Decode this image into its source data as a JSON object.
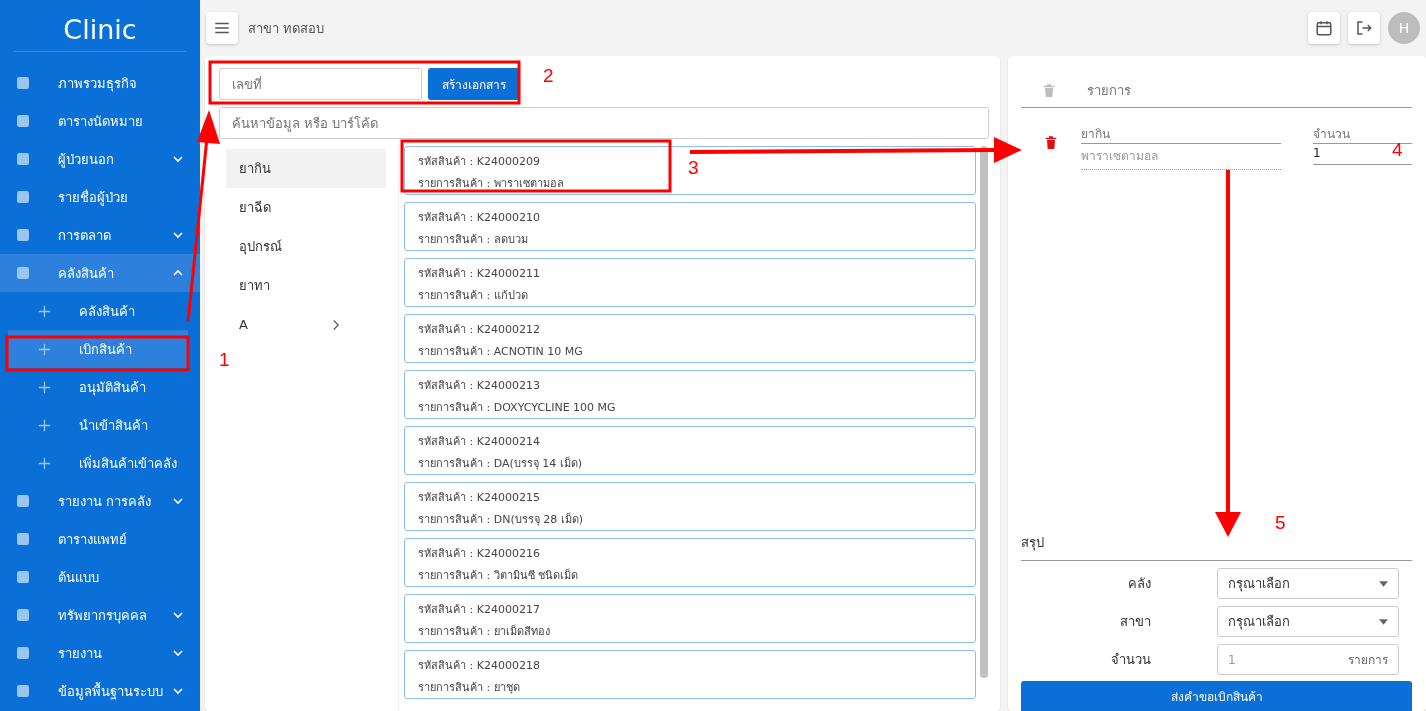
{
  "sidebar": {
    "logo": "Clinic",
    "items": [
      {
        "label": "ภาพรวมธุรกิจ",
        "selected": false
      },
      {
        "label": "ตารางนัดหมาย",
        "selected": false
      },
      {
        "label": "ผู้ป่วยนอก",
        "selected": false,
        "expanded": false
      },
      {
        "label": "รายชื่อผู้ป่วย",
        "selected": false
      },
      {
        "label": "การตลาด",
        "selected": false,
        "expanded": false
      },
      {
        "label": "คลังสินค้า",
        "selected": false,
        "expanded": true,
        "children": [
          {
            "label": "คลังสินค้า",
            "selected": false
          },
          {
            "label": "เบิกสินค้า",
            "selected": true
          },
          {
            "label": "อนุมัติสินค้า",
            "selected": false
          },
          {
            "label": "นำเข้าสินค้า",
            "selected": false
          },
          {
            "label": "เพิ่มสินค้าเข้าคลัง",
            "selected": false
          }
        ]
      },
      {
        "label": "รายงาน การคลัง",
        "selected": false,
        "expanded": false
      },
      {
        "label": "ตารางแพทย์",
        "selected": false
      },
      {
        "label": "ต้นแบบ",
        "selected": false
      },
      {
        "label": "ทรัพยากรบุคคล",
        "selected": false,
        "expanded": false
      },
      {
        "label": "รายงาน",
        "selected": false,
        "expanded": false
      },
      {
        "label": "ข้อมูลพื้นฐานระบบ",
        "selected": false,
        "expanded": false
      }
    ]
  },
  "topbar": {
    "branch": "สาขา ทดสอบ",
    "avatar": "H"
  },
  "document": {
    "number_placeholder": "เลขที่",
    "create_button": "สร้างเอกสาร",
    "search_placeholder": "ค้นหาข้อมูล หรือ บาร์โค้ด"
  },
  "categories": [
    {
      "label": "ยากิน",
      "selected": true,
      "kind": "item"
    },
    {
      "label": "ยาฉีด",
      "selected": false,
      "kind": "item"
    },
    {
      "label": "อุปกรณ์",
      "selected": false,
      "kind": "item"
    },
    {
      "label": "ยาทา",
      "selected": false,
      "kind": "item"
    },
    {
      "label": "A",
      "selected": false,
      "kind": "group"
    }
  ],
  "products": [
    {
      "code": "รหัสสินค้า : K24000209",
      "name": "รายการสินค้า : พาราเซตามอล"
    },
    {
      "code": "รหัสสินค้า : K24000210",
      "name": "รายการสินค้า : ลดบวม"
    },
    {
      "code": "รหัสสินค้า : K24000211",
      "name": "รายการสินค้า : แก้ปวด"
    },
    {
      "code": "รหัสสินค้า : K24000212",
      "name": "รายการสินค้า : ACNOTIN 10 MG"
    },
    {
      "code": "รหัสสินค้า : K24000213",
      "name": "รายการสินค้า : DOXYCYCLINE 100 MG"
    },
    {
      "code": "รหัสสินค้า : K24000214",
      "name": "รายการสินค้า : DA(บรรจุ 14 เม็ด)"
    },
    {
      "code": "รหัสสินค้า : K24000215",
      "name": "รายการสินค้า : DN(บรรจุ 28 เม็ด)"
    },
    {
      "code": "รหัสสินค้า : K24000216",
      "name": "รายการสินค้า : วิตามินซี ชนิดเม็ด"
    },
    {
      "code": "รหัสสินค้า : K24000217",
      "name": "รายการสินค้า : ยาเม็ดสีทอง"
    },
    {
      "code": "รหัสสินค้า : K24000218",
      "name": "รายการสินค้า : ยาชุด"
    }
  ],
  "cart": {
    "header": "รายการ",
    "lines": [
      {
        "category": "ยากิน",
        "name": "พาราเซตามอล",
        "quantity_label": "จำนวน",
        "quantity": "1"
      }
    ]
  },
  "summary": {
    "title": "สรุป",
    "fields": [
      {
        "kind": "select",
        "label": "คลัง",
        "value": "กรุณาเลือก"
      },
      {
        "kind": "select",
        "label": "สาขา",
        "value": "กรุณาเลือก"
      },
      {
        "kind": "number",
        "label": "จำนวน",
        "placeholder": "1",
        "suffix": "รายการ"
      }
    ],
    "submit": "ส่งคำขอเบิกสินค้า"
  },
  "annotations": [
    {
      "label": "1"
    },
    {
      "label": "2"
    },
    {
      "label": "3"
    },
    {
      "label": "4"
    },
    {
      "label": "5"
    }
  ]
}
